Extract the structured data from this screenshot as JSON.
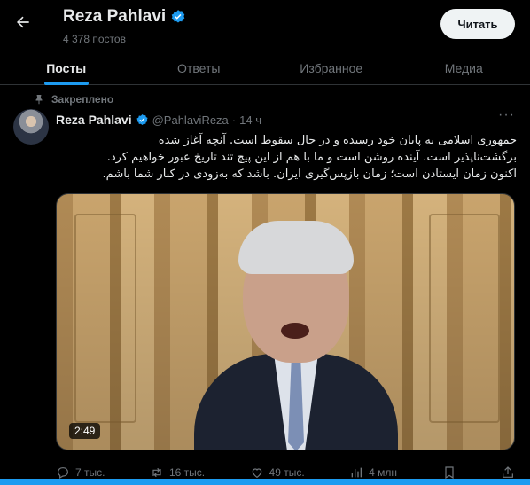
{
  "header": {
    "title": "Reza Pahlavi",
    "post_count": "4 378 постов",
    "follow_label": "Читать",
    "back_icon": "arrow-left-icon",
    "verified_icon": "verified-badge-icon"
  },
  "tabs": [
    {
      "label": "Посты",
      "active": true
    },
    {
      "label": "Ответы",
      "active": false
    },
    {
      "label": "Избранное",
      "active": false
    },
    {
      "label": "Медиа",
      "active": false
    }
  ],
  "post": {
    "pinned_label": "Закреплено",
    "author_name": "Reza Pahlavi",
    "handle": "@PahlaviReza",
    "separator": "·",
    "time": "14 ч",
    "text_lines": [
      "جمهوری اسلامی به پایان خود رسیده و در حال سقوط است. آنچه آغاز شده",
      "برگشت‌ناپذیر است. آینده روشن است و ما با هم از این پیچ تند تاریخ عبور خواهیم کرد.",
      "اکنون زمان ایستادن است؛ زمان بازپس‌گیری ایران. باشد که به‌زودی در کنار شما باشم."
    ],
    "video_duration": "2:49",
    "actions": {
      "replies": "7 тыс.",
      "reposts": "16 тыс.",
      "likes": "49 тыс.",
      "views": "4 млн"
    }
  },
  "colors": {
    "background": "#000000",
    "accent": "#1d9bf0",
    "text_primary": "#e7e9ea",
    "text_secondary": "#71767b"
  }
}
